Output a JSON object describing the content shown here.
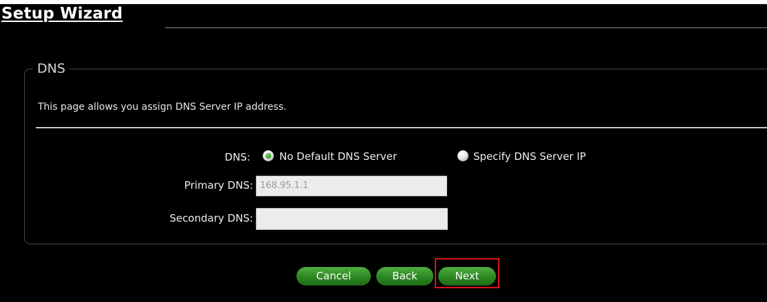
{
  "page": {
    "title": "Setup Wizard"
  },
  "section": {
    "legend": "DNS",
    "description": "This page allows you assign DNS Server IP address."
  },
  "form": {
    "dns_label": "DNS:",
    "dns_options": [
      {
        "label": "No Default DNS Server",
        "selected": true
      },
      {
        "label": "Specify DNS Server IP",
        "selected": false
      }
    ],
    "primary_label": "Primary DNS:",
    "primary_value": "168.95.1.1",
    "secondary_label": "Secondary DNS:",
    "secondary_value": ""
  },
  "buttons": {
    "cancel": "Cancel",
    "back": "Back",
    "next": "Next"
  },
  "colors": {
    "background": "#000000",
    "button_green": "#2f8a24",
    "highlight_red": "#e01414"
  }
}
